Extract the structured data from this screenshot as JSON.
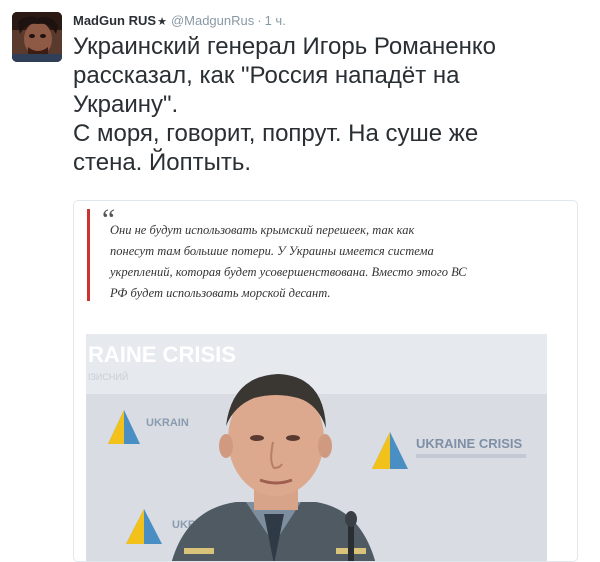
{
  "tweet": {
    "display_name": "MadGun RUS",
    "username": "@MadgunRus",
    "separator": "·",
    "time": "1 ч.",
    "text_lines": [
      "Украинский генерал Игорь Романенко",
      "рассказал, как \"Россия нападёт на",
      "Украину\".",
      "С моря, говорит, попрут. На суше же",
      "стена. Йоптыть."
    ]
  },
  "card": {
    "quote_mark": "“",
    "quote_lines": [
      "Они не будут использовать крымский перешеек, так как",
      "понесут там большие потери. У Украины имеется система",
      "укреплений, которая будет усовершенствована. Вместо этого ВС",
      "РФ будет использовать морской десант."
    ],
    "photo": {
      "backdrop_text": "RAINE CRISIS",
      "backdrop_subtext": "ІЗИСНИЙ",
      "logo_text_1": "UKRAINE CRISIS",
      "logo_text_2": "UKRAIN",
      "logo_text_3": "UKRAIN",
      "colors": {
        "background": "#d9dde3",
        "accent_blue": "#4a8fc4",
        "accent_yellow": "#f2c11a",
        "uniform": "#4f5a63"
      }
    }
  },
  "icons": {
    "verified_star": "star-icon",
    "quote": "quote-icon"
  }
}
